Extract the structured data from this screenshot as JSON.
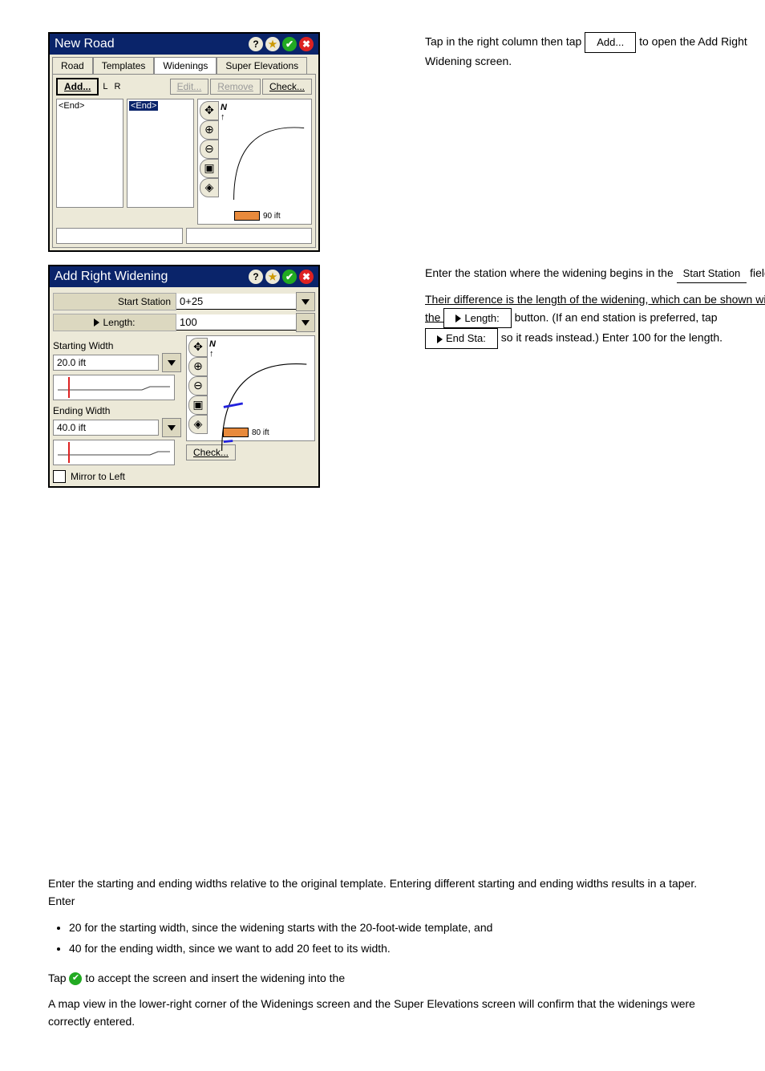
{
  "dialog1": {
    "title": "New Road",
    "tabs": [
      "Road",
      "Templates",
      "Widenings",
      "Super Elevations"
    ],
    "active_tab": 2,
    "buttons": {
      "add": "Add...",
      "edit": "Edit...",
      "remove": "Remove",
      "check": "Check..."
    },
    "side_labels": {
      "l": "L",
      "r": "R"
    },
    "list_left": "<End>",
    "list_right": "<End>",
    "scale_label": "90 ift",
    "north": "N"
  },
  "dialog2": {
    "title": "Add Right Widening",
    "start_station_label": "Start Station",
    "start_station_value": "0+25",
    "length_label": "Length:",
    "length_value": "100",
    "starting_width_label": "Starting Width",
    "starting_width_value": "20.0 ift",
    "ending_width_label": "Ending Width",
    "ending_width_value": "40.0 ift",
    "mirror_label": "Mirror to Left",
    "check_label": "Check...",
    "scale_label": "80 ift",
    "north": "N"
  },
  "instr1": {
    "pre": "Tap in the right column then tap ",
    "btn": "Add...",
    "post": " to open the Add Right Widening screen."
  },
  "instr2": {
    "l1_pre": "Enter the station where the widening begins in the ",
    "l1_link": "Start Station",
    "l1_post": " field.",
    "l2": "Their difference is the length of the widening, which can be shown with the ",
    "length_btn": "Length:",
    "l2_mid": " button. (If an end station is preferred, tap ",
    "end_btn": "End Sta:",
    "l2_post": " so it reads  instead.) Enter 100 for the length."
  },
  "bottom": {
    "p1": "Enter the starting and ending widths relative to the original template. Entering different starting and ending widths results in a taper. Enter",
    "li1": "20 for the starting width, since the widening starts with the 20-foot-wide template, and",
    "li2": "40 for the ending width, since we want to add 20 feet to its width.",
    "p2_pre": "Tap ",
    "p2_post": " to accept the screen and insert the widening into the",
    "p3": "A map view in the lower-right corner of the Widenings screen and the Super Elevations screen will confirm that the widenings were correctly entered."
  }
}
